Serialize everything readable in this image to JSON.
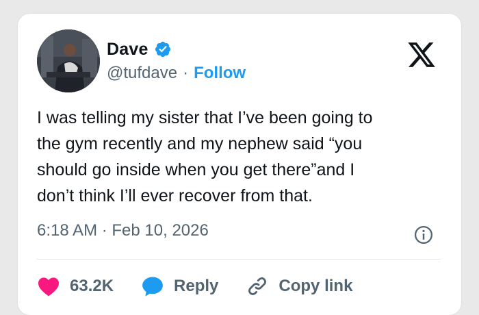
{
  "author": {
    "name": "Dave",
    "handle": "@tufdave",
    "separator": "·",
    "follow_label": "Follow",
    "verified": true
  },
  "tweet": {
    "text": "I was telling my sister that I’ve been going to\nthe gym recently and my nephew said “you\nshould go inside when you get there”and I\ndon’t think I’ll ever recover from that.",
    "timestamp": "6:18 AM · Feb 10, 2026"
  },
  "actions": {
    "likes": "63.2K",
    "reply_label": "Reply",
    "copy_label": "Copy link"
  },
  "icons": {
    "brand": "x-logo-icon",
    "verified": "verified-badge-icon",
    "info": "info-icon",
    "like": "heart-icon",
    "reply": "speech-bubble-icon",
    "copy": "link-icon"
  },
  "colors": {
    "accent": "#1d9bf0",
    "like": "#f91880",
    "text": "#0f1419",
    "muted": "#536471"
  }
}
